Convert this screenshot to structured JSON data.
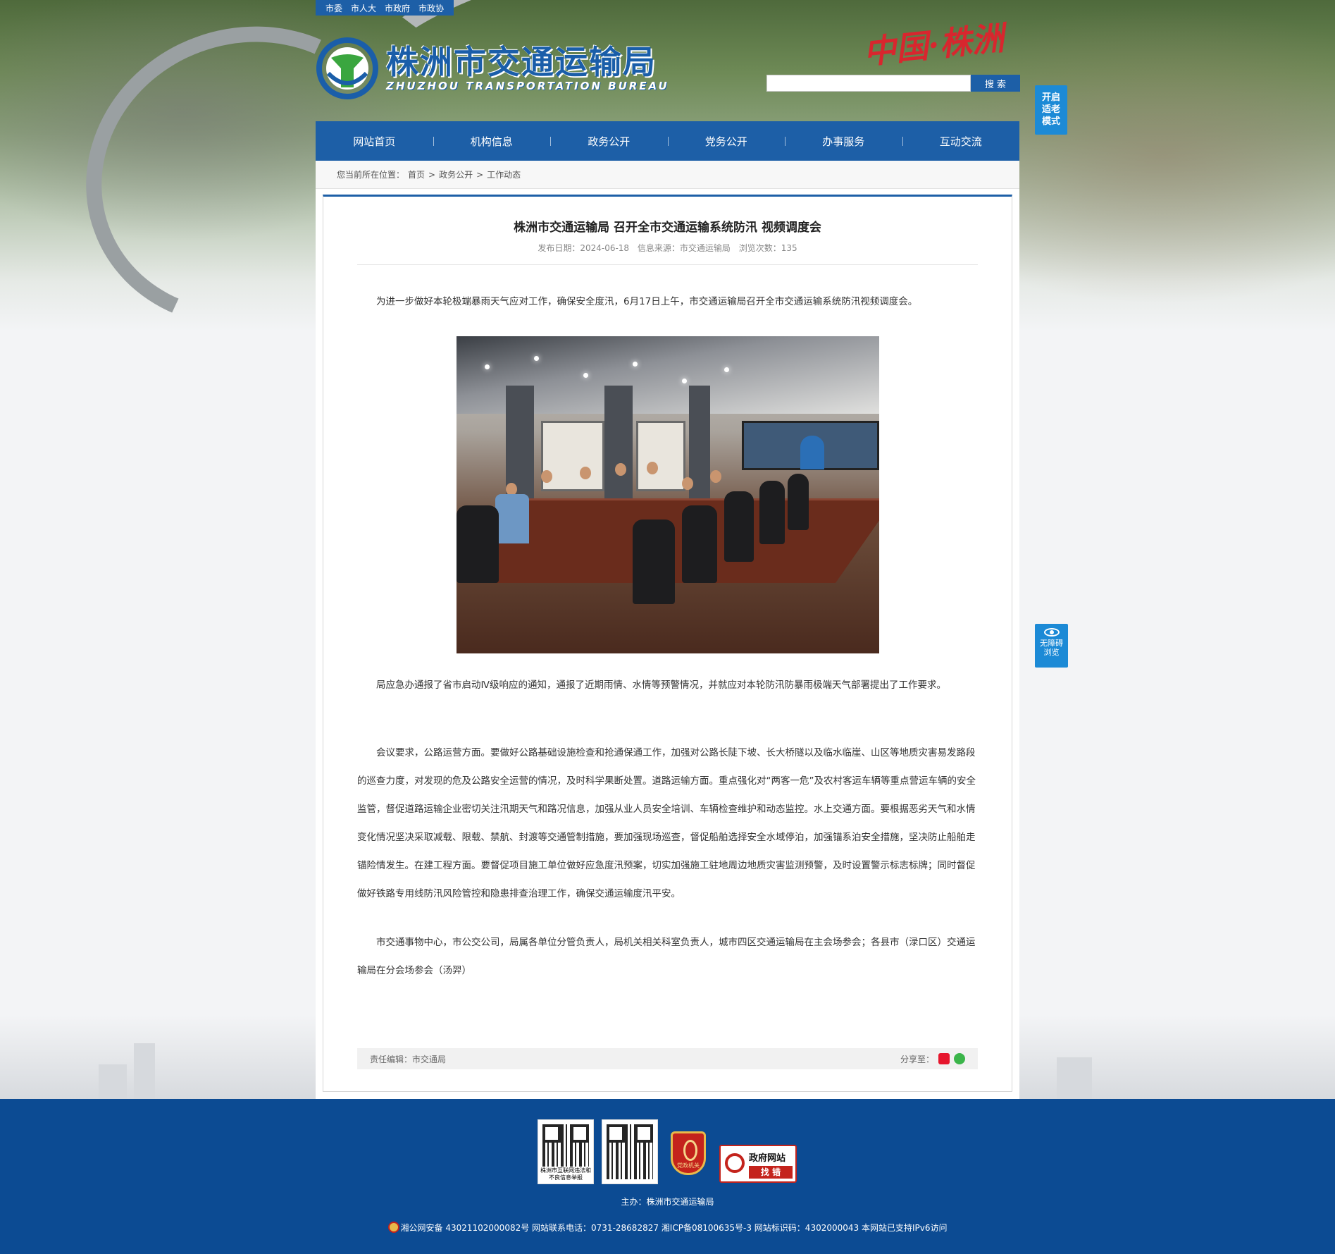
{
  "top_links": [
    "市委",
    "市人大",
    "市政府",
    "市政协"
  ],
  "logo": {
    "cn": "株洲市交通运输局",
    "en": "ZHUZHOU TRANSPORTATION BUREAU"
  },
  "slogan": "中国·株洲",
  "search": {
    "placeholder": "",
    "button": "搜 索"
  },
  "elder_mode": "开启适老模式",
  "accessibility": {
    "label": "无障碍浏览"
  },
  "nav": [
    "网站首页",
    "机构信息",
    "政务公开",
    "党务公开",
    "办事服务",
    "互动交流"
  ],
  "breadcrumb": {
    "prefix": "您当前所在位置：",
    "items": [
      "首页",
      "政务公开",
      "工作动态"
    ],
    "sep": ">"
  },
  "article": {
    "title": "株洲市交通运输局 召开全市交通运输系统防汛 视频调度会",
    "date_label": "发布日期：2024-06-18",
    "source_label": "信息来源：市交通运输局",
    "views_label": "浏览次数：135",
    "paragraphs": [
      "为进一步做好本轮极端暴雨天气应对工作，确保安全度汛，6月17日上午，市交通运输局召开全市交通运输系统防汛视频调度会。",
      "局应急办通报了省市启动Ⅳ级响应的通知，通报了近期雨情、水情等预警情况，并就应对本轮防汛防暴雨极端天气部署提出了工作要求。",
      "会议要求，公路运营方面。要做好公路基础设施检查和抢通保通工作，加强对公路长陡下坡、长大桥隧以及临水临崖、山区等地质灾害易发路段的巡查力度，对发现的危及公路安全运营的情况，及时科学果断处置。道路运输方面。重点强化对“两客一危”及农村客运车辆等重点营运车辆的安全监管，督促道路运输企业密切关注汛期天气和路况信息，加强从业人员安全培训、车辆检查维护和动态监控。水上交通方面。要根据恶劣天气和水情变化情况坚决采取减载、限载、禁航、封渡等交通管制措施，要加强现场巡查，督促船舶选择安全水域停泊，加强锚系泊安全措施，坚决防止船舶走锚险情发生。在建工程方面。要督促项目施工单位做好应急度汛预案，切实加强施工驻地周边地质灾害监测预警，及时设置警示标志标牌；同时督促做好铁路专用线防汛风险管控和隐患排查治理工作，确保交通运输度汛平安。",
      "市交通事物中心，市公交公司，局属各单位分管负责人，局机关相关科室负责人，城市四区交通运输局在主会场参会；各县市（渌口区）交通运输局在分会场参会（汤羿）"
    ],
    "editor": "责任编辑：市交通局",
    "share_label": "分享至："
  },
  "footer": {
    "qr1_caption": "株洲市互联网违法和不良信息举报",
    "badge": "党政机关",
    "findbug_title": "政府网站",
    "findbug_action": "找 错",
    "host": "主办：株洲市交通运输局",
    "record": "湘公网安备 43021102000082号  网站联系电话：0731-28682827  湘ICP备08100635号-3  网站标识码：4302000043  本网站已支持IPv6访问"
  },
  "colors": {
    "primary": "#1d5fa7",
    "footer": "#0c4b93",
    "side_button": "#1c8ad6"
  }
}
